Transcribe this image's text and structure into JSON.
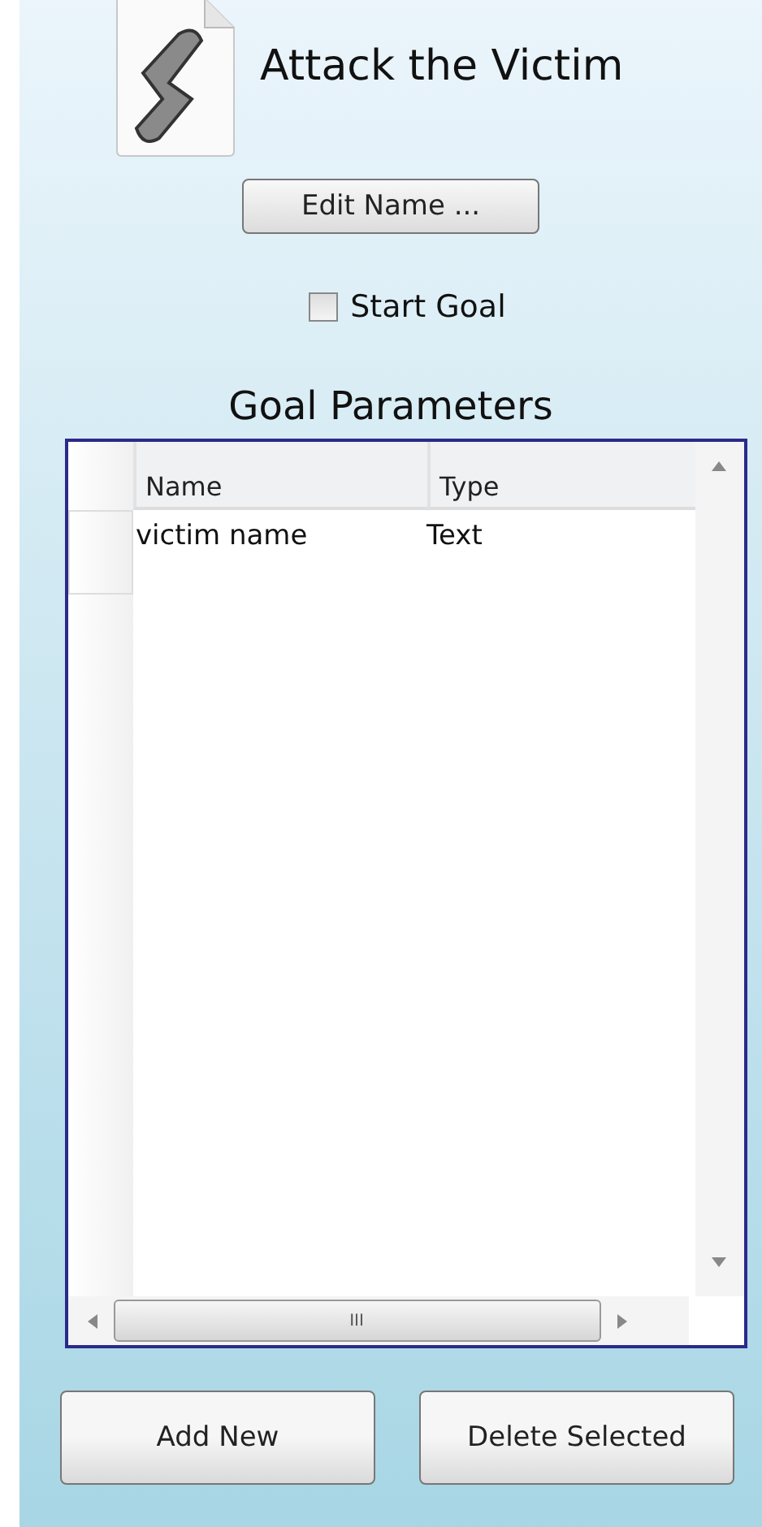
{
  "goal": {
    "title": "Attack the Victim",
    "edit_button": "Edit Name ...",
    "start_goal": {
      "label": "Start Goal",
      "checked": false
    }
  },
  "parameters": {
    "heading": "Goal Parameters",
    "columns": [
      "Name",
      "Type"
    ],
    "rows": [
      {
        "name": "victim name",
        "type": "Text"
      }
    ],
    "scroll_grip": "III"
  },
  "buttons": [
    "Add New",
    "Delete Selected"
  ]
}
